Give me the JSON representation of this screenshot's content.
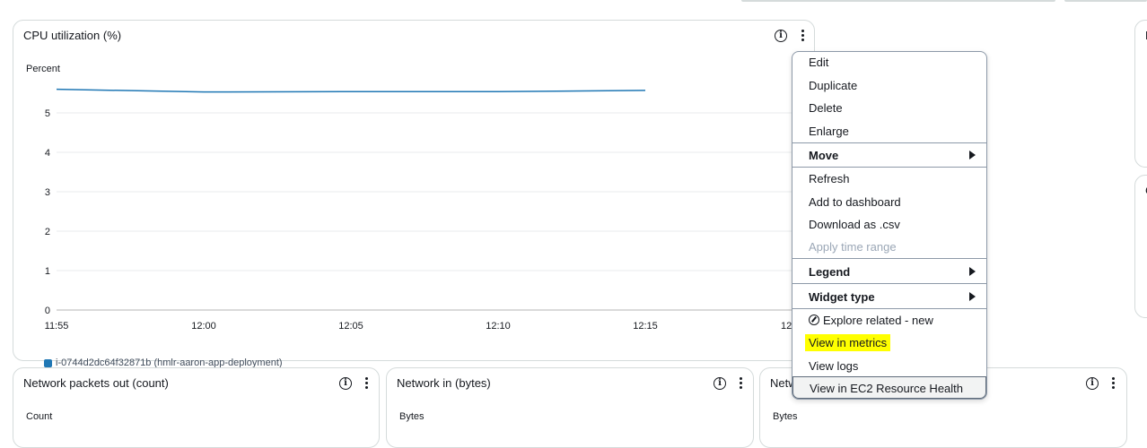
{
  "top_widgets": {
    "cpu": {
      "title": "CPU utilization (%)",
      "unit": "Percent"
    }
  },
  "bottom_widgets": [
    {
      "title": "Network packets out (count)",
      "unit": "Count"
    },
    {
      "title": "Network in (bytes)",
      "unit": "Bytes"
    },
    {
      "title": "Netw",
      "unit": "Bytes"
    }
  ],
  "right_partial": [
    {
      "title": "N"
    },
    {
      "title": "C"
    }
  ],
  "context_menu": {
    "edit": "Edit",
    "duplicate": "Duplicate",
    "delete": "Delete",
    "enlarge": "Enlarge",
    "move": "Move",
    "refresh": "Refresh",
    "add_to_dashboard": "Add to dashboard",
    "download_csv": "Download as .csv",
    "apply_time_range": "Apply time range",
    "legend": "Legend",
    "widget_type": "Widget type",
    "explore_related": "Explore related - new",
    "view_in_metrics": "View in metrics",
    "view_logs": "View logs",
    "view_ec2_health": "View in EC2 Resource Health"
  },
  "colors": {
    "series": "#1f77b4",
    "highlight": "#ffff00"
  },
  "chart_data": {
    "type": "line",
    "title": "CPU utilization (%)",
    "ylabel": "Percent",
    "ylim": [
      0,
      5.5
    ],
    "yticks": [
      0,
      1,
      2,
      3,
      4,
      5
    ],
    "xticks": [
      "11:55",
      "12:00",
      "12:05",
      "12:10",
      "12:15",
      "12:"
    ],
    "series": [
      {
        "name": "i-0744d2dc64f32871b (hmlr-aaron-app-deployment)",
        "x": [
          "11:55",
          "12:00",
          "12:05",
          "12:10",
          "12:15"
        ],
        "values": [
          5.6,
          5.53,
          5.54,
          5.54,
          5.57
        ]
      }
    ]
  }
}
